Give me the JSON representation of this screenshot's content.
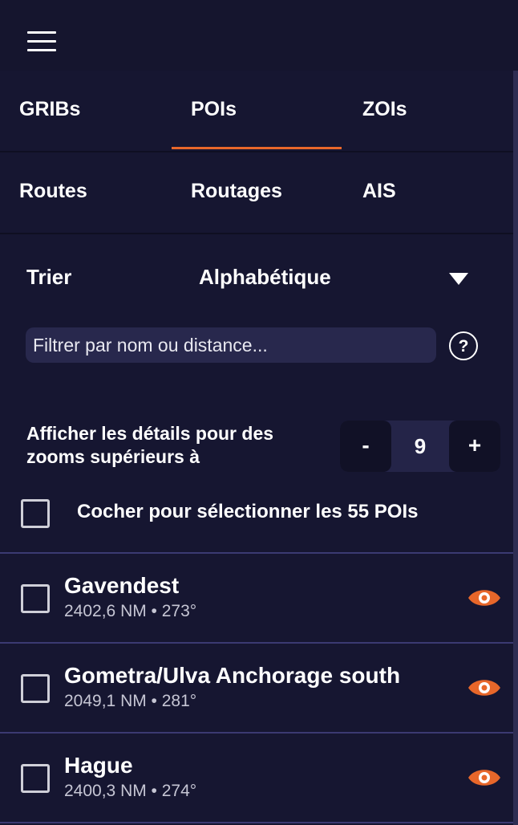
{
  "menu": {
    "icon": "hamburger-menu-icon"
  },
  "tabs": {
    "row1": [
      {
        "label": "GRIBs",
        "active": false
      },
      {
        "label": "POIs",
        "active": true
      },
      {
        "label": "ZOIs",
        "active": false
      }
    ],
    "row2": [
      {
        "label": "Routes",
        "active": false
      },
      {
        "label": "Routages",
        "active": false
      },
      {
        "label": "AIS",
        "active": false
      }
    ]
  },
  "sort": {
    "label": "Trier",
    "value": "Alphabétique",
    "icon": "triangle-down-icon"
  },
  "filter": {
    "placeholder": "Filtrer par nom ou distance...",
    "value": "",
    "help_label": "?"
  },
  "zoom": {
    "label": "Afficher les détails pour des zooms supérieurs à",
    "minus": "-",
    "value": "9",
    "plus": "+"
  },
  "select_all": {
    "label": "Cocher pour sélectionner les 55 POIs",
    "checked": false
  },
  "pois": [
    {
      "name": "Gavendest",
      "meta": "2402,6 NM • 273°",
      "checked": false,
      "visible": true
    },
    {
      "name": "Gometra/Ulva Anchorage south",
      "meta": "2049,1 NM • 281°",
      "checked": false,
      "visible": true
    },
    {
      "name": "Hague",
      "meta": "2400,3 NM • 274°",
      "checked": false,
      "visible": true
    }
  ],
  "colors": {
    "accent": "#e8672a",
    "background": "#15152e",
    "panel": "#161631",
    "separator": "#3b3a72"
  }
}
